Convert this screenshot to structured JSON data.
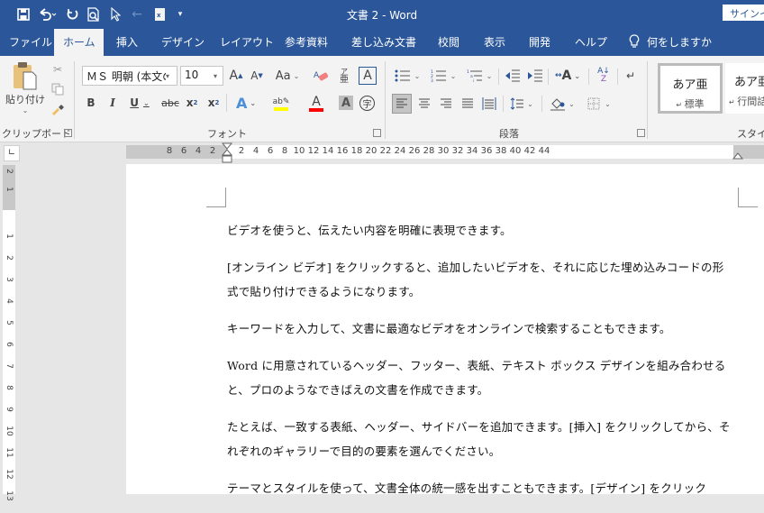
{
  "window": {
    "title": "文書 2  -  Word",
    "signin_label": "サインイン"
  },
  "quick_access": [
    {
      "name": "save-icon"
    },
    {
      "name": "undo-icon"
    },
    {
      "name": "redo-icon"
    },
    {
      "name": "print-preview-icon"
    },
    {
      "name": "select-cursor-icon"
    },
    {
      "name": "back-arrow-icon"
    },
    {
      "name": "excel-icon"
    },
    {
      "name": "customize-qat-icon"
    }
  ],
  "tabs": [
    {
      "label": "ファイル",
      "active": false
    },
    {
      "label": "ホーム",
      "active": true
    },
    {
      "label": "挿入",
      "active": false
    },
    {
      "label": "デザイン",
      "active": false
    },
    {
      "label": "レイアウト",
      "active": false
    },
    {
      "label": "参考資料",
      "active": false
    },
    {
      "label": "差し込み文書",
      "active": false
    },
    {
      "label": "校閲",
      "active": false
    },
    {
      "label": "表示",
      "active": false
    },
    {
      "label": "開発",
      "active": false
    },
    {
      "label": "ヘルプ",
      "active": false
    }
  ],
  "tell_me": "何をしますか",
  "ribbon": {
    "clipboard": {
      "label": "クリップボード",
      "paste_label": "貼り付け"
    },
    "font": {
      "label": "フォント",
      "font_name": "ＭＳ 明朝 (本文のフ",
      "font_size": "10",
      "highlight_color": "#ffff00",
      "font_color": "#ff0000"
    },
    "paragraph": {
      "label": "段落"
    },
    "styles": {
      "label": "スタイル",
      "items": [
        {
          "sample": "あア亜",
          "name": "標準",
          "selected": true
        },
        {
          "sample": "あア亜",
          "name": "行間詰め",
          "selected": false
        }
      ]
    }
  },
  "ruler": {
    "h_ticks": [
      "8",
      "6",
      "4",
      "2",
      "2",
      "4",
      "6",
      "8",
      "10",
      "12",
      "14",
      "16",
      "18",
      "20",
      "22",
      "24",
      "26",
      "28",
      "30",
      "32",
      "34",
      "36",
      "38",
      "40",
      "42",
      "44"
    ],
    "v_ticks": [
      "2",
      "1",
      "1",
      "2",
      "3",
      "4",
      "5",
      "6",
      "7",
      "8",
      "9",
      "10",
      "11",
      "12",
      "13"
    ]
  },
  "document": {
    "paragraphs": [
      "ビデオを使うと、伝えたい内容を明確に表現できます。",
      "[オンライン ビデオ] をクリックすると、追加したいビデオを、それに応じた埋め込みコードの形式で貼り付けできるようになります。",
      "キーワードを入力して、文書に最適なビデオをオンラインで検索することもできます。",
      "Word に用意されているヘッダー、フッター、表紙、テキスト ボックス デザインを組み合わせると、プロのようなできばえの文書を作成できます。",
      "たとえば、一致する表紙、ヘッダー、サイドバーを追加できます。[挿入] をクリックしてから、それぞれのギャラリーで目的の要素を選んでください。",
      "テーマとスタイルを使って、文書全体の統一感を出すこともできます。[デザイン] をクリック"
    ]
  }
}
